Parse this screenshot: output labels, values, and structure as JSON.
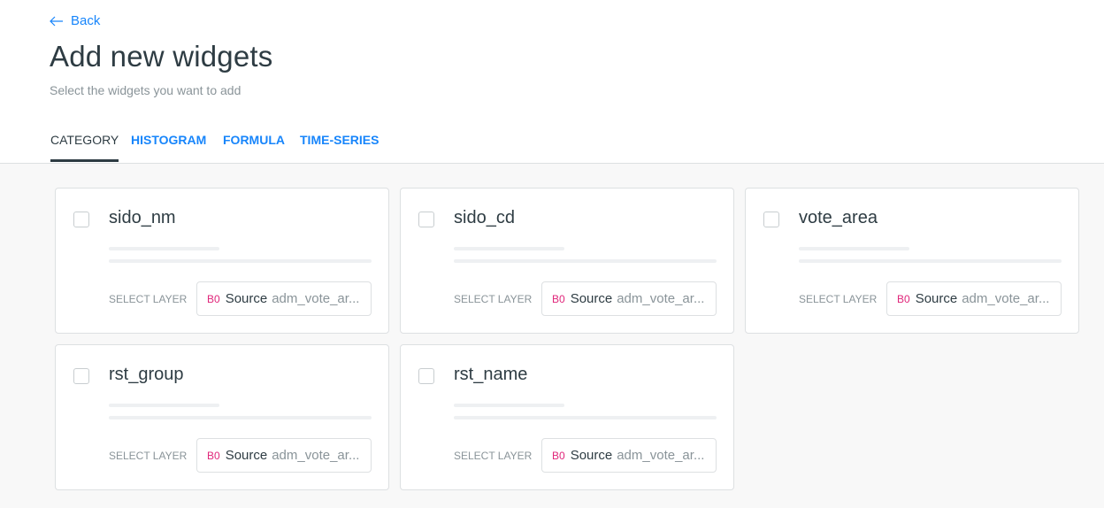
{
  "header": {
    "back_label": "Back",
    "title": "Add new widgets",
    "subtitle": "Select the widgets you want to add"
  },
  "tabs": [
    {
      "label": "CATEGORY",
      "active": true
    },
    {
      "label": "HISTOGRAM",
      "active": false
    },
    {
      "label": "FORMULA",
      "active": false
    },
    {
      "label": "TIME-SERIES",
      "active": false
    }
  ],
  "widgets": [
    {
      "title": "sido_nm",
      "checked": false,
      "select_label": "SELECT LAYER",
      "layer_badge": "B0",
      "layer_source": "Source",
      "layer_name": "adm_vote_ar..."
    },
    {
      "title": "sido_cd",
      "checked": false,
      "select_label": "SELECT LAYER",
      "layer_badge": "B0",
      "layer_source": "Source",
      "layer_name": "adm_vote_ar..."
    },
    {
      "title": "vote_area",
      "checked": false,
      "select_label": "SELECT LAYER",
      "layer_badge": "B0",
      "layer_source": "Source",
      "layer_name": "adm_vote_ar..."
    },
    {
      "title": "rst_group",
      "checked": false,
      "select_label": "SELECT LAYER",
      "layer_badge": "B0",
      "layer_source": "Source",
      "layer_name": "adm_vote_ar..."
    },
    {
      "title": "rst_name",
      "checked": false,
      "select_label": "SELECT LAYER",
      "layer_badge": "B0",
      "layer_source": "Source",
      "layer_name": "adm_vote_ar..."
    }
  ],
  "colors": {
    "accent": "#1785fb",
    "text": "#2e3c43",
    "muted": "#8a9499",
    "badge": "#e0267a"
  }
}
